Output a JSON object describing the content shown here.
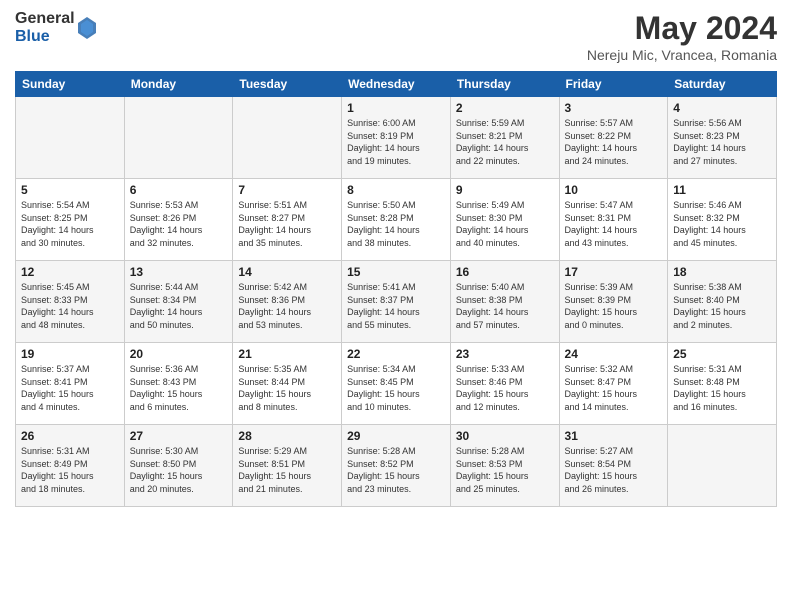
{
  "header": {
    "logo_general": "General",
    "logo_blue": "Blue",
    "month_title": "May 2024",
    "location": "Nereju Mic, Vrancea, Romania"
  },
  "days_of_week": [
    "Sunday",
    "Monday",
    "Tuesday",
    "Wednesday",
    "Thursday",
    "Friday",
    "Saturday"
  ],
  "weeks": [
    [
      {
        "day": "",
        "info": ""
      },
      {
        "day": "",
        "info": ""
      },
      {
        "day": "",
        "info": ""
      },
      {
        "day": "1",
        "info": "Sunrise: 6:00 AM\nSunset: 8:19 PM\nDaylight: 14 hours\nand 19 minutes."
      },
      {
        "day": "2",
        "info": "Sunrise: 5:59 AM\nSunset: 8:21 PM\nDaylight: 14 hours\nand 22 minutes."
      },
      {
        "day": "3",
        "info": "Sunrise: 5:57 AM\nSunset: 8:22 PM\nDaylight: 14 hours\nand 24 minutes."
      },
      {
        "day": "4",
        "info": "Sunrise: 5:56 AM\nSunset: 8:23 PM\nDaylight: 14 hours\nand 27 minutes."
      }
    ],
    [
      {
        "day": "5",
        "info": "Sunrise: 5:54 AM\nSunset: 8:25 PM\nDaylight: 14 hours\nand 30 minutes."
      },
      {
        "day": "6",
        "info": "Sunrise: 5:53 AM\nSunset: 8:26 PM\nDaylight: 14 hours\nand 32 minutes."
      },
      {
        "day": "7",
        "info": "Sunrise: 5:51 AM\nSunset: 8:27 PM\nDaylight: 14 hours\nand 35 minutes."
      },
      {
        "day": "8",
        "info": "Sunrise: 5:50 AM\nSunset: 8:28 PM\nDaylight: 14 hours\nand 38 minutes."
      },
      {
        "day": "9",
        "info": "Sunrise: 5:49 AM\nSunset: 8:30 PM\nDaylight: 14 hours\nand 40 minutes."
      },
      {
        "day": "10",
        "info": "Sunrise: 5:47 AM\nSunset: 8:31 PM\nDaylight: 14 hours\nand 43 minutes."
      },
      {
        "day": "11",
        "info": "Sunrise: 5:46 AM\nSunset: 8:32 PM\nDaylight: 14 hours\nand 45 minutes."
      }
    ],
    [
      {
        "day": "12",
        "info": "Sunrise: 5:45 AM\nSunset: 8:33 PM\nDaylight: 14 hours\nand 48 minutes."
      },
      {
        "day": "13",
        "info": "Sunrise: 5:44 AM\nSunset: 8:34 PM\nDaylight: 14 hours\nand 50 minutes."
      },
      {
        "day": "14",
        "info": "Sunrise: 5:42 AM\nSunset: 8:36 PM\nDaylight: 14 hours\nand 53 minutes."
      },
      {
        "day": "15",
        "info": "Sunrise: 5:41 AM\nSunset: 8:37 PM\nDaylight: 14 hours\nand 55 minutes."
      },
      {
        "day": "16",
        "info": "Sunrise: 5:40 AM\nSunset: 8:38 PM\nDaylight: 14 hours\nand 57 minutes."
      },
      {
        "day": "17",
        "info": "Sunrise: 5:39 AM\nSunset: 8:39 PM\nDaylight: 15 hours\nand 0 minutes."
      },
      {
        "day": "18",
        "info": "Sunrise: 5:38 AM\nSunset: 8:40 PM\nDaylight: 15 hours\nand 2 minutes."
      }
    ],
    [
      {
        "day": "19",
        "info": "Sunrise: 5:37 AM\nSunset: 8:41 PM\nDaylight: 15 hours\nand 4 minutes."
      },
      {
        "day": "20",
        "info": "Sunrise: 5:36 AM\nSunset: 8:43 PM\nDaylight: 15 hours\nand 6 minutes."
      },
      {
        "day": "21",
        "info": "Sunrise: 5:35 AM\nSunset: 8:44 PM\nDaylight: 15 hours\nand 8 minutes."
      },
      {
        "day": "22",
        "info": "Sunrise: 5:34 AM\nSunset: 8:45 PM\nDaylight: 15 hours\nand 10 minutes."
      },
      {
        "day": "23",
        "info": "Sunrise: 5:33 AM\nSunset: 8:46 PM\nDaylight: 15 hours\nand 12 minutes."
      },
      {
        "day": "24",
        "info": "Sunrise: 5:32 AM\nSunset: 8:47 PM\nDaylight: 15 hours\nand 14 minutes."
      },
      {
        "day": "25",
        "info": "Sunrise: 5:31 AM\nSunset: 8:48 PM\nDaylight: 15 hours\nand 16 minutes."
      }
    ],
    [
      {
        "day": "26",
        "info": "Sunrise: 5:31 AM\nSunset: 8:49 PM\nDaylight: 15 hours\nand 18 minutes."
      },
      {
        "day": "27",
        "info": "Sunrise: 5:30 AM\nSunset: 8:50 PM\nDaylight: 15 hours\nand 20 minutes."
      },
      {
        "day": "28",
        "info": "Sunrise: 5:29 AM\nSunset: 8:51 PM\nDaylight: 15 hours\nand 21 minutes."
      },
      {
        "day": "29",
        "info": "Sunrise: 5:28 AM\nSunset: 8:52 PM\nDaylight: 15 hours\nand 23 minutes."
      },
      {
        "day": "30",
        "info": "Sunrise: 5:28 AM\nSunset: 8:53 PM\nDaylight: 15 hours\nand 25 minutes."
      },
      {
        "day": "31",
        "info": "Sunrise: 5:27 AM\nSunset: 8:54 PM\nDaylight: 15 hours\nand 26 minutes."
      },
      {
        "day": "",
        "info": ""
      }
    ]
  ]
}
